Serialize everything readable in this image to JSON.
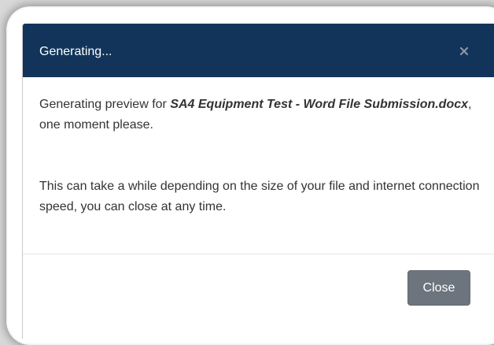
{
  "dialog": {
    "title": "Generating...",
    "message": {
      "prefix": "Generating preview for ",
      "filename": "SA4 Equipment Test - Word File Submission.docx",
      "suffix": ", one moment please."
    },
    "note": "This can take a while depending on the size of your file and internet connection speed, you can close at any time.",
    "close_label": "Close",
    "close_icon": "close-icon"
  },
  "colors": {
    "header_bg": "#12345a",
    "button_bg": "#6c757d",
    "text": "#333333"
  }
}
